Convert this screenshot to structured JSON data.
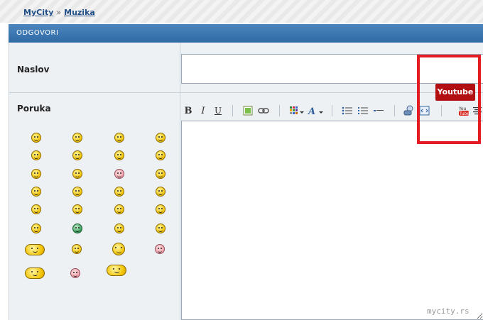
{
  "breadcrumb": {
    "home": "MyCity",
    "separator": "»",
    "section": "Muzika"
  },
  "header": {
    "title": "ODGOVORI"
  },
  "form": {
    "title_label": "Naslov",
    "title_value": "",
    "message_label": "Poruka"
  },
  "toolbar": {
    "bold": "B",
    "italic": "I",
    "underline": "U",
    "tooltip": "Youtube"
  },
  "colors": {
    "accent": "#2f6aa4",
    "tooltip_bg": "#b20f12",
    "highlight": "#e51b24"
  },
  "icons": [
    "bold-icon",
    "italic-icon",
    "underline-icon",
    "insert-image-icon",
    "insert-link-icon",
    "color-icon",
    "font-size-icon",
    "bullet-list-icon",
    "numbered-list-icon",
    "horizontal-rule-icon",
    "quote-icon",
    "code-icon",
    "youtube-icon",
    "align-icon"
  ],
  "watermark": "mycity.rs"
}
